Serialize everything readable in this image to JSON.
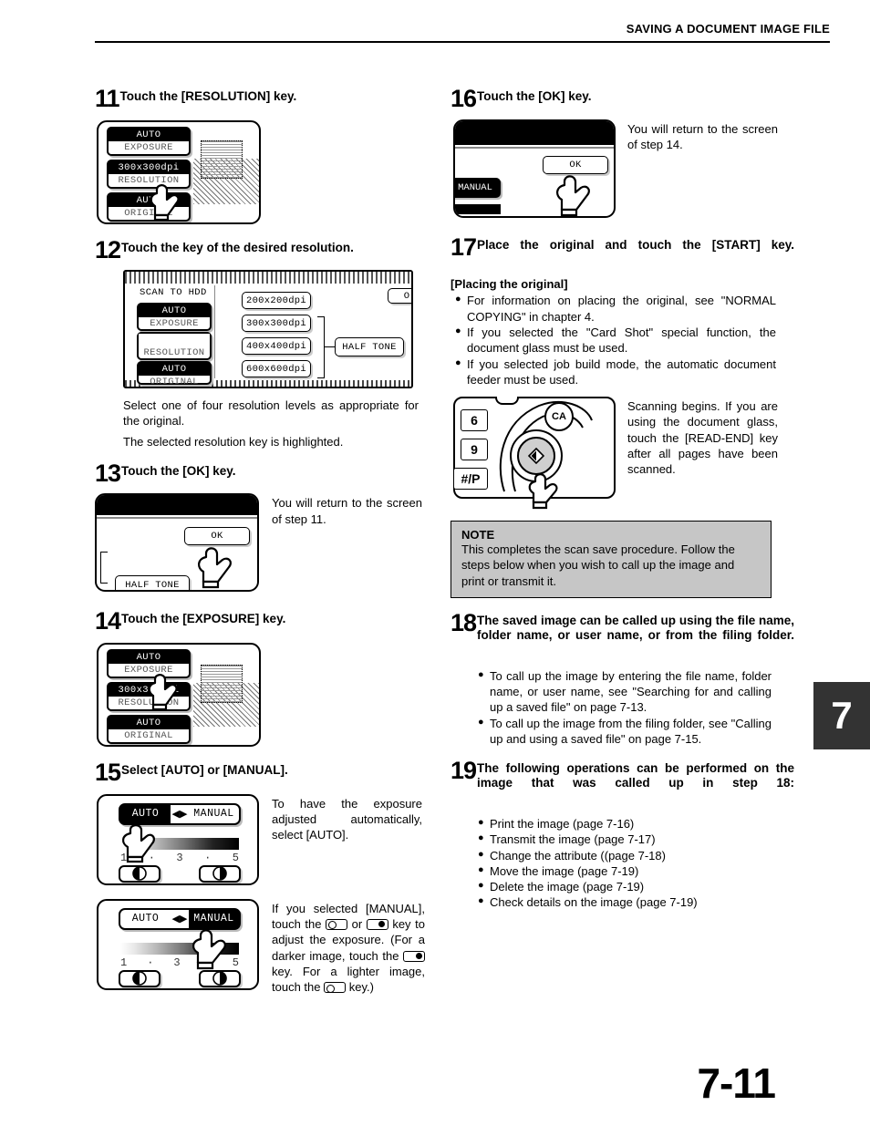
{
  "header": {
    "title": "SAVING A DOCUMENT IMAGE FILE"
  },
  "chapter_tab": "7",
  "page_number": "7-11",
  "steps": {
    "s11": {
      "num": "11",
      "text": "Touch the [RESOLUTION] key."
    },
    "s12": {
      "num": "12",
      "text": "Touch the key of the desired resolution.",
      "caption1": "Select one of four resolution levels as appropriate for the original.",
      "caption2": "The selected resolution key is highlighted."
    },
    "s13": {
      "num": "13",
      "text": "Touch the [OK] key.",
      "side": "You will return to the screen of step 11."
    },
    "s14": {
      "num": "14",
      "text": "Touch the [EXPOSURE] key."
    },
    "s15": {
      "num": "15",
      "text": "Select [AUTO] or [MANUAL].",
      "side_auto": "To have the exposure adjusted automatically, select [AUTO].",
      "side_manual_a": "If you selected [MANUAL], touch the",
      "side_manual_b": "or",
      "side_manual_c": "key to adjust the exposure.",
      "side_manual_d": "(For a darker image, touch the",
      "side_manual_e": "key. For a lighter image, touch the",
      "side_manual_f": "key.)"
    },
    "s16": {
      "num": "16",
      "text": "Touch the [OK] key.",
      "side": "You will return to the screen of step 14."
    },
    "s17": {
      "num": "17",
      "text": "Place the original and touch the [START] key.",
      "subheading": "[Placing the original]",
      "bullets": [
        "For information on placing the original, see \"NORMAL COPYING\" in chapter 4.",
        "If you selected the \"Card Shot\" special function, the document glass must be used.",
        "If you selected job build mode, the automatic document feeder must be used."
      ],
      "side": "Scanning begins. If you are using the document glass, touch the [READ-END] key after all pages have been scanned."
    },
    "s18": {
      "num": "18",
      "text": "The saved image can be called up using the file name, folder name, or user name, or from the filing folder.",
      "bullets": [
        "To call up the image by entering the file name, folder name, or user name, see \"Searching for and calling up a saved file\" on page 7-13.",
        "To call up the image from the filing folder, see \"Calling up and using a saved file\" on page 7-15."
      ]
    },
    "s19": {
      "num": "19",
      "text": "The following operations can be performed on the image that was called up in step 18:",
      "bullets": [
        "Print the image (page 7-16)",
        "Transmit the image (page 7-17)",
        "Change the attribute ((page 7-18)",
        "Move the image (page 7-19)",
        "Delete the image (page 7-19)",
        "Check details on the image (page 7-19)"
      ]
    }
  },
  "note": {
    "title": "NOTE",
    "body": "This completes the scan save procedure. Follow the steps below when you wish to call up the image and print or transmit it."
  },
  "panels": {
    "settings_panel": {
      "exposure_value": "AUTO",
      "exposure_label": "EXPOSURE",
      "resolution_value": "300x300dpi",
      "resolution_label": "RESOLUTION",
      "original_value": "AUTO",
      "original_label": "ORIGINAL"
    },
    "resolution_screen": {
      "mode_title": "SCAN TO HDD",
      "ok_label": "O",
      "exposure_value": "AUTO",
      "exposure_label": "EXPOSURE",
      "resolution_label": "RESOLUTION",
      "original_value": "AUTO",
      "original_label": "ORIGINAL",
      "options": [
        "200x200dpi",
        "300x300dpi",
        "400x400dpi",
        "600x600dpi"
      ],
      "halftone_label": "HALF TONE"
    },
    "ok_screen_13": {
      "ok_label": "OK",
      "halftone_label": "HALF TONE"
    },
    "ok_screen_16": {
      "ok_label": "OK",
      "manual_label": "MANUAL"
    },
    "exposure_auto": {
      "auto_label": "AUTO",
      "manual_label": "MANUAL",
      "scale": [
        "1",
        "·",
        "3",
        "·",
        "5"
      ]
    },
    "exposure_manual": {
      "auto_label": "AUTO",
      "manual_label": "MANUAL",
      "scale": [
        "1",
        "·",
        "3",
        "·",
        "5"
      ]
    },
    "keypad": {
      "keys": [
        "6",
        "9",
        "#/P"
      ],
      "ca_label": "CA"
    }
  }
}
